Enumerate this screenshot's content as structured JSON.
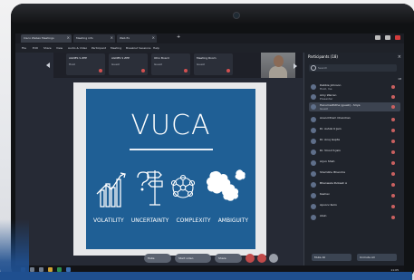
{
  "browser": {
    "tabs": [
      {
        "label": "Cisco Webex Meetings"
      },
      {
        "label": "Meeting info"
      },
      {
        "label": "Web Ex"
      }
    ],
    "menu": [
      "File",
      "Edit",
      "Share",
      "View",
      "Audio & Video",
      "Participant",
      "Meeting",
      "Breakout Sessions",
      "Help"
    ]
  },
  "tiles": [
    {
      "name": "AGNES S ZEE",
      "sub": "Host"
    },
    {
      "name": "AGNES S ZEE",
      "sub": "Guest"
    },
    {
      "name": "Ohio Board",
      "sub": "Guest"
    },
    {
      "name": "Meeting Room",
      "sub": "Guest"
    }
  ],
  "slide": {
    "title": "VUCA",
    "words": [
      "VOLATILITY",
      "UNCERTAINTY",
      "COMPLEXITY",
      "AMBIGUITY"
    ]
  },
  "participants_panel": {
    "title": "Participants (18)",
    "search_placeholder": "Search",
    "count_label": "18",
    "items": [
      {
        "name": "Debbie Johnson",
        "sub": "Host, me"
      },
      {
        "name": "Amy Warren",
        "sub": "Presenter"
      },
      {
        "name": "Hanumadhitha (guest) - Sriya",
        "sub": "Guest"
      },
      {
        "name": "Anand Prem Chandran",
        "sub": ""
      },
      {
        "name": "Dr. Ashok K Jain",
        "sub": ""
      },
      {
        "name": "Dr. Anuj Gupta",
        "sub": ""
      },
      {
        "name": "Dr. Vinod S Jain",
        "sub": ""
      },
      {
        "name": "Arjun Shah",
        "sub": ""
      },
      {
        "name": "Shambhu Bhendra",
        "sub": ""
      },
      {
        "name": "Bhanwala Pulkesh A",
        "sub": ""
      },
      {
        "name": "Keshav",
        "sub": ""
      },
      {
        "name": "Apoorv Kulin",
        "sub": ""
      },
      {
        "name": "Alain",
        "sub": ""
      }
    ],
    "buttons": [
      "Mute All",
      "Unmute All"
    ]
  },
  "controls": {
    "mute_label": "Mute",
    "video_label": "Start video",
    "share_label": "Share"
  },
  "taskbar": {
    "time": "11:05"
  },
  "colors": {
    "slide_blue": "#1f5f95",
    "panel_bg": "#20242c",
    "accent_blue": "#1f4f8f",
    "mute_red": "#d43c3c"
  }
}
